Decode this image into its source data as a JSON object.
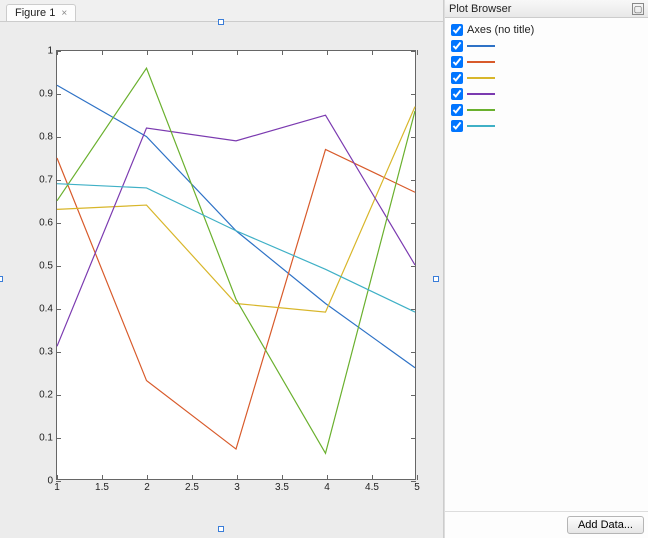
{
  "tabs": {
    "figure_label": "Figure 1"
  },
  "browser": {
    "title": "Plot Browser",
    "axes_label": "Axes (no title)",
    "add_data_label": "Add Data..."
  },
  "colors": {
    "series": [
      "#2e72c6",
      "#d85a2a",
      "#d8b62a",
      "#7b3ab0",
      "#6ab02e",
      "#3fb0c6"
    ],
    "handle": "#3a7dd8"
  },
  "chart_data": {
    "type": "line",
    "x": [
      1,
      2,
      3,
      4,
      5
    ],
    "xticks": [
      1,
      1.5,
      2,
      2.5,
      3,
      3.5,
      4,
      4.5,
      5
    ],
    "yticks": [
      0,
      0.1,
      0.2,
      0.3,
      0.4,
      0.5,
      0.6,
      0.7,
      0.8,
      0.9,
      1
    ],
    "xlim": [
      1,
      5
    ],
    "ylim": [
      0,
      1
    ],
    "xlabel": "",
    "ylabel": "",
    "title": "",
    "series": [
      {
        "name": "",
        "color_index": 0,
        "values": [
          0.92,
          0.8,
          0.58,
          0.41,
          0.26
        ]
      },
      {
        "name": "",
        "color_index": 1,
        "values": [
          0.75,
          0.23,
          0.07,
          0.77,
          0.67
        ]
      },
      {
        "name": "",
        "color_index": 2,
        "values": [
          0.63,
          0.64,
          0.41,
          0.39,
          0.87
        ]
      },
      {
        "name": "",
        "color_index": 3,
        "values": [
          0.31,
          0.82,
          0.79,
          0.85,
          0.5
        ]
      },
      {
        "name": "",
        "color_index": 4,
        "values": [
          0.65,
          0.96,
          0.42,
          0.06,
          0.86
        ]
      },
      {
        "name": "",
        "color_index": 5,
        "values": [
          0.69,
          0.68,
          0.58,
          0.49,
          0.39
        ]
      }
    ]
  }
}
